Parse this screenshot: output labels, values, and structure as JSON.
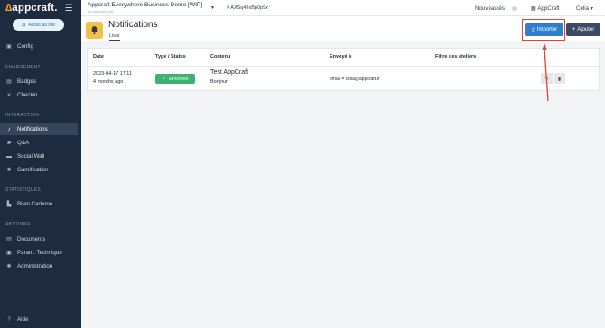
{
  "sidebar": {
    "logo": "appcraft.",
    "site_button": "Accès au site",
    "items": [
      {
        "label": "Config",
        "icon": "square-icon"
      },
      {
        "label": "Badges",
        "icon": "badge-icon"
      },
      {
        "label": "Checkin",
        "icon": "scan-icon"
      },
      {
        "label": "Notifications",
        "icon": "bell-icon"
      },
      {
        "label": "Q&A",
        "icon": "chat-icon"
      },
      {
        "label": "Social Wall",
        "icon": "wall-icon"
      },
      {
        "label": "Gamification",
        "icon": "gear-icon"
      },
      {
        "label": "Bilan Carbone",
        "icon": "factory-icon"
      },
      {
        "label": "Documents",
        "icon": "print-icon"
      },
      {
        "label": "Param. Technique",
        "icon": "square-icon"
      },
      {
        "label": "Administration",
        "icon": "gear-icon"
      }
    ],
    "sections": {
      "emargement": "EMARGEMENT",
      "interaction": "INTERACTION",
      "statistiques": "STATISTIQUES",
      "settings": "SETTINGS"
    },
    "help": "Aide"
  },
  "topbar": {
    "project": "Appcraft Everywhere Business Demo [WIP]",
    "project_sub": "do not touch yet",
    "hash": "AXSq49xBp0p9x",
    "news": "Nouveautés",
    "app": "AppCraft",
    "user": "Célia"
  },
  "header": {
    "title": "Notifications",
    "tab": "Liste",
    "import": "Importer",
    "add": "Ajouter"
  },
  "table": {
    "columns": [
      "Date",
      "Type / Status",
      "Contenu",
      "Envoyé à",
      "Filtre des ateliers"
    ],
    "rows": [
      {
        "date": "2023-04-17 17:11",
        "date_rel": "4 months ago",
        "status": "Envoyée",
        "content_title": "Test AppCraft",
        "content_body": "Bonjour",
        "sent_to": "email = celia@appcraft.fr",
        "filter": ""
      }
    ]
  },
  "colors": {
    "sidebar": "#1e2a3e",
    "primary": "#2f7fd1",
    "dark_button": "#3c4a63",
    "success": "#3cb371",
    "highlight": "#e5413a",
    "bell": "#f0c24b"
  }
}
